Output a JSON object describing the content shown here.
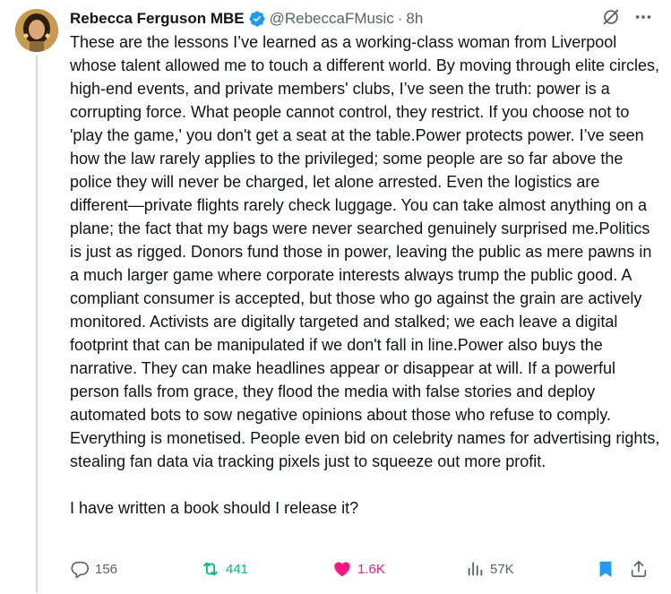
{
  "author": {
    "name": "Rebecca Ferguson MBE",
    "handle": "@RebeccaFMusic",
    "separator": "·",
    "time": "8h"
  },
  "tweet": {
    "text": "These are the lessons I’ve learned as a working-class woman from Liverpool whose talent allowed me to touch a different world. By moving through elite circles, high-end events, and private members' clubs, I’ve seen the truth: power is a corrupting force. What people cannot control, they restrict. If you choose not to 'play the game,' you don't get a seat at the table.Power protects power. I’ve seen how the law rarely applies to the privileged; some people are so far above the police they will never be charged, let alone arrested. Even the logistics are different—private flights rarely check luggage. You can take almost anything on a plane; the fact that my bags were never searched genuinely surprised me.Politics is just as rigged. Donors fund those in power, leaving the public as mere pawns in a much larger game where corporate interests always trump the public good. A compliant consumer is accepted, but those who go against the grain are actively monitored. Activists are digitally targeted and stalked; we each leave a digital footprint that can be manipulated if we don't fall in line.Power also buys the narrative. They can make headlines appear or disappear at will. If a powerful person falls from grace, they flood the media with false stories and deploy automated bots to sow negative opinions about those who refuse to comply. Everything is monetised. People even bid on celebrity names for advertising rights, stealing fan data via tracking pixels just to squeeze out more profit.\n\nI have written a book should I release it?"
  },
  "metrics": {
    "replies": "156",
    "retweets": "441",
    "likes": "1.6K",
    "views": "57K"
  },
  "icons": {
    "verified": "verified-badge-icon",
    "grok": "grok-icon",
    "more": "more-icon",
    "reply": "reply-icon",
    "retweet": "retweet-icon",
    "like": "heart-icon",
    "views": "views-icon",
    "bookmark": "bookmark-icon",
    "share": "share-icon"
  },
  "colors": {
    "verified": "#1d9bf0",
    "retweet_active": "#00ba7c",
    "like_active": "#f91880",
    "bookmark_active": "#1d9bf0",
    "muted": "#536471",
    "text": "#0f1419"
  }
}
